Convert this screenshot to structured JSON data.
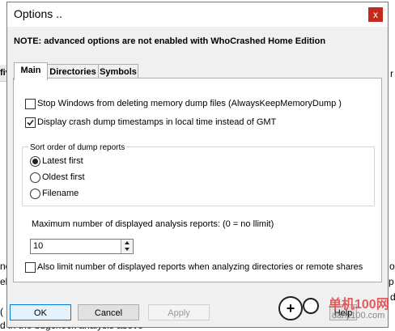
{
  "background": {
    "bg_fragments": [
      "fiv",
      "not",
      "el",
      "(",
      "d in the bugcheck analysis above",
      "o",
      "rp",
      "d",
      "r"
    ]
  },
  "dialog": {
    "title": "Options ..",
    "close_glyph": "x",
    "note": "NOTE:  advanced options are not enabled with WhoCrashed Home Edition",
    "tabs": [
      "Main",
      "Directories",
      "Symbols"
    ],
    "options": {
      "stop_windows_label": "Stop Windows from deleting memory dump files  (AlwaysKeepMemoryDump )",
      "stop_windows_checked": false,
      "display_local_label": "Display crash dump timestamps in local time instead of GMT",
      "display_local_checked": true,
      "sort_group_label": "Sort order of dump reports",
      "sort_options": [
        "Latest first",
        "Oldest first",
        "Filename"
      ],
      "sort_selected": "Latest first",
      "max_reports_label": "Maximum number of displayed analysis reports: (0 = no llimit)",
      "max_reports_value": "10",
      "limit_label": "Also limit number of displayed reports when analyzing directories or remote shares",
      "limit_checked": false
    },
    "buttons": {
      "ok": "OK",
      "cancel": "Cancel",
      "apply": "Apply",
      "help": "Help"
    }
  },
  "watermark": {
    "text1": "单机100网",
    "text2": "danji100.com"
  },
  "colors": {
    "close": "#c42b1c",
    "accent": "#0078d7"
  }
}
